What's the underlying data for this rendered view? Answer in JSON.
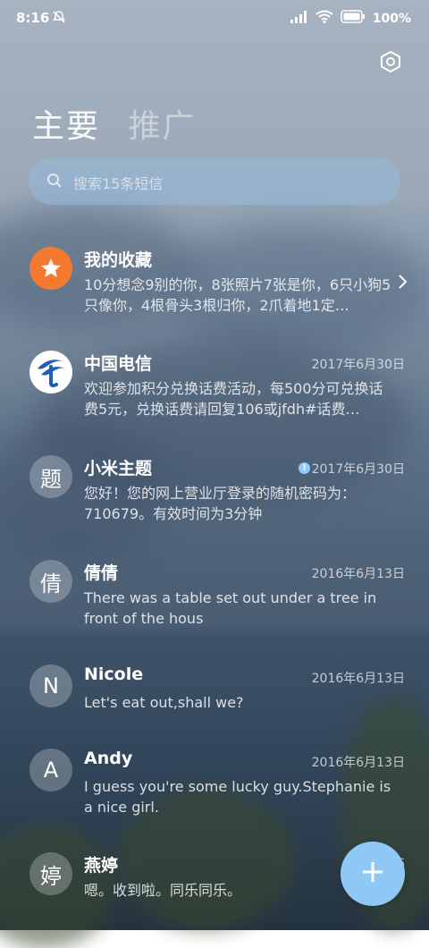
{
  "status_bar": {
    "time": "8:16",
    "battery": "100%"
  },
  "tabs": [
    {
      "label": "主要"
    },
    {
      "label": "推广"
    }
  ],
  "search": {
    "placeholder": "搜索15条短信"
  },
  "threads": [
    {
      "name": "我的收藏",
      "avatar_glyph": "★",
      "avatar_type": "favorites",
      "date": "",
      "preview": "10分想念9别的你，8张照片7张是你，6只小狗5只像你，4根骨头3根归你，2爪着地1定…"
    },
    {
      "name": "中国电信",
      "avatar_glyph": "",
      "avatar_type": "telecom-logo",
      "date": "2017年6月30日",
      "preview": "欢迎参加积分兑换话费活动，每500分可兑换话费5元，兑换话费请回复106或jfdh#话费…"
    },
    {
      "name": "小米主题",
      "avatar_glyph": "题",
      "avatar_type": "glyph",
      "date": "2017年6月30日",
      "unread_warning": true,
      "preview": "您好！您的网上营业厅登录的随机密码为：710679。有效时间为3分钟"
    },
    {
      "name": "倩倩",
      "avatar_glyph": "倩",
      "avatar_type": "glyph",
      "date": "2016年6月13日",
      "preview": "There was a table set out under a tree in front of the hous"
    },
    {
      "name": "Nicole",
      "avatar_glyph": "N",
      "avatar_type": "glyph",
      "date": "2016年6月13日",
      "preview": "Let's eat out,shall we?"
    },
    {
      "name": "Andy",
      "avatar_glyph": "A",
      "avatar_type": "glyph",
      "date": "2016年6月13日",
      "preview": "I guess you're some lucky guy.Stephanie is a nice girl."
    },
    {
      "name": "燕婷",
      "avatar_glyph": "婷",
      "avatar_type": "glyph",
      "date": "2016",
      "preview": "嗯。收到啦。同乐同乐。"
    }
  ],
  "colors": {
    "fab": "#8ec8f4",
    "favorites_avatar": "#f47a32",
    "telecom_blue": "#1d5fb3",
    "warning_dot": "#8ec8ff"
  },
  "icons": [
    "bell-off-icon",
    "signal-icon",
    "wifi-icon",
    "battery-icon",
    "settings-icon",
    "search-icon",
    "chevron-right-icon",
    "plus-icon",
    "star-icon",
    "telecom-logo-icon",
    "alert-icon"
  ]
}
